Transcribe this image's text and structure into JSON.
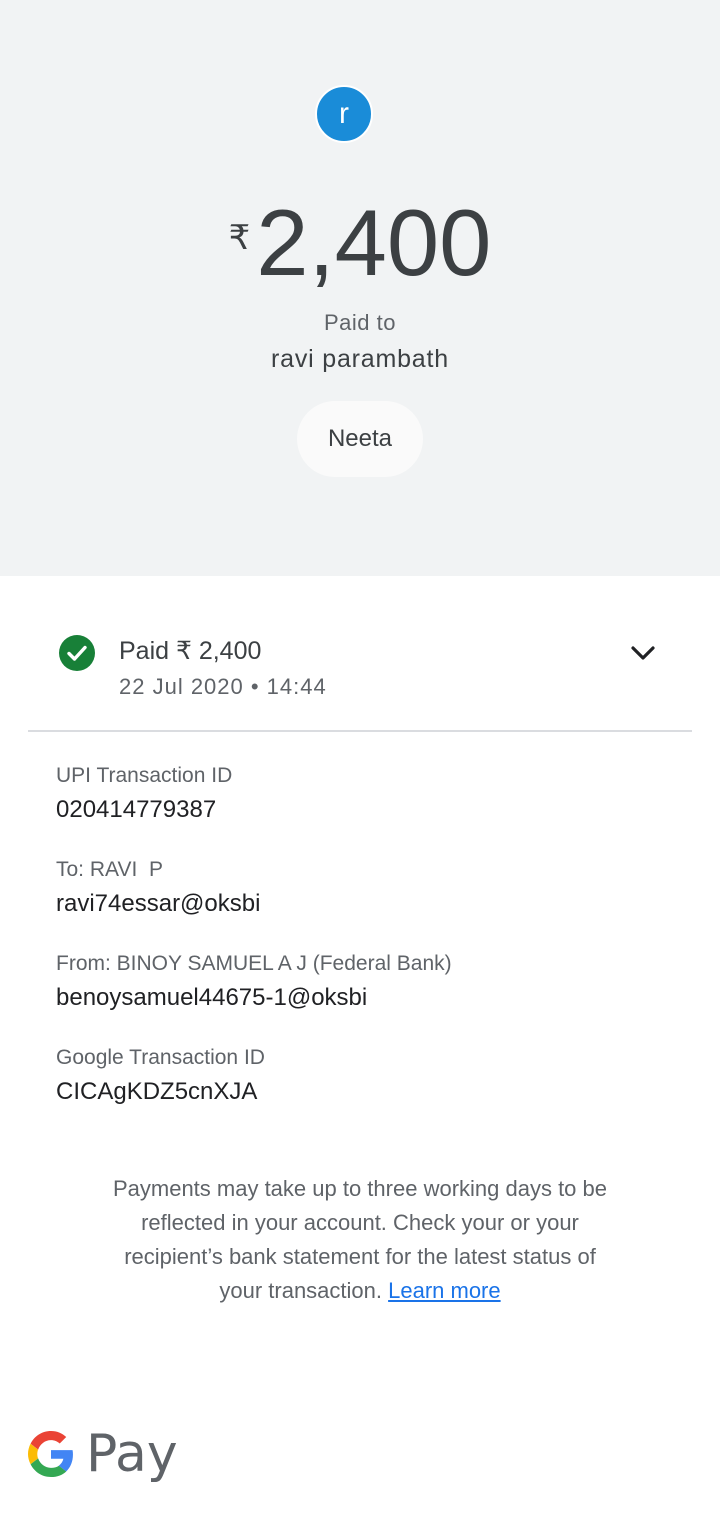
{
  "header": {
    "avatar_letter": "r",
    "currency_symbol": "₹",
    "amount": "2,400",
    "paid_to_label": "Paid to",
    "payee_name": "ravi parambath",
    "note": "Neeta"
  },
  "status": {
    "title": "Paid ₹ 2,400",
    "datetime": "22 Jul 2020 • 14:44",
    "icon": "check-circle-icon",
    "expand_icon": "chevron-down-icon",
    "color": "#188038"
  },
  "details": [
    {
      "label": "UPI Transaction ID",
      "value": "020414779387"
    },
    {
      "label": "To: RAVI  P",
      "value": "ravi74essar@oksbi"
    },
    {
      "label": "From: BINOY SAMUEL A J (Federal Bank)",
      "value": "benoysamuel44675-1@oksbi"
    },
    {
      "label": "Google Transaction ID",
      "value": "CICAgKDZ5cnXJA"
    }
  ],
  "disclaimer": {
    "text": "Payments may take up to three working days to be reflected in your account. Check your or your recipient’s bank statement for the latest status of your transaction. ",
    "link": "Learn more"
  },
  "footer": {
    "logo_text": "Pay"
  },
  "colors": {
    "avatar": "#1a8cd8",
    "link": "#1a73e8",
    "header_bg": "#f1f3f4"
  }
}
